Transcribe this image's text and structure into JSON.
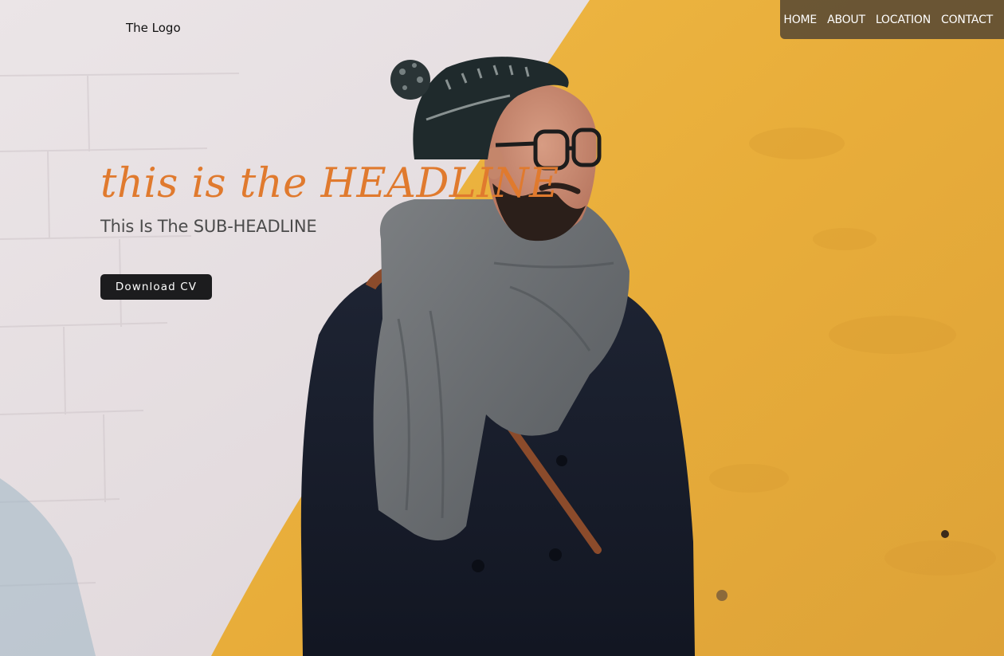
{
  "header": {
    "logo": "The Logo"
  },
  "nav": {
    "items": [
      {
        "label": "HOME"
      },
      {
        "label": "ABOUT"
      },
      {
        "label": "LOCATION"
      },
      {
        "label": "CONTACT"
      }
    ]
  },
  "hero": {
    "headline": "this is the HEADLINE",
    "subheadline": "This Is The SUB-HEADLINE",
    "cta_label": "Download CV",
    "image_description_icon": "person-photo"
  },
  "colors": {
    "headline": "#e07a2e",
    "wall_white": "#e8e2e4",
    "wall_yellow": "#eab040",
    "nav_bg": "#463c32",
    "button_bg": "#1c1c1e"
  }
}
